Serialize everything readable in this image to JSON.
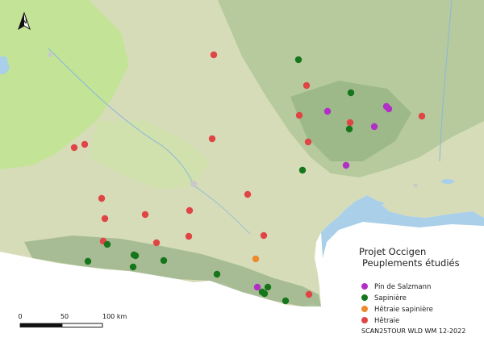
{
  "legend": {
    "title": "Projet Occigen",
    "subtitle": "Peuplements étudiés",
    "items": [
      {
        "label": "Pin de Salzmann",
        "color": "#b12fc6"
      },
      {
        "label": "Sapinière",
        "color": "#16761c"
      },
      {
        "label": "Hêtraie sapinière",
        "color": "#ee8a2b"
      },
      {
        "label": "Hêtraie",
        "color": "#e04545"
      }
    ]
  },
  "scale": {
    "labels": [
      "0",
      "50",
      "100 km"
    ]
  },
  "credit": "SCAN25TOUR WLD WM 12-2022",
  "north_arrow": {
    "icon": "north-arrow-icon",
    "letter": "N"
  },
  "colors": {
    "sea": "#a9cfe9",
    "land": "#d6dcb8",
    "plains": "#bfe58f",
    "mountains": "#9fb68d"
  }
}
